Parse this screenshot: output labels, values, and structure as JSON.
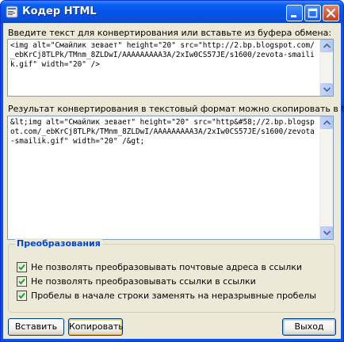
{
  "window": {
    "title": "Кодер HTML"
  },
  "input_section": {
    "label": "Введите текст для конвертирования или вставьте из буфера обмена:",
    "value": "<img alt=\"Смайлик зевает\" height=\"20\" src=\"http://2.bp.blogspot.com/_ebKrCj8TLPk/TMnm_8ZLDwI/AAAAAAAAA3A/2xIw0CS57JE/s1600/zevota-smailik.gif\" width=\"20\" />"
  },
  "output_section": {
    "label": "Результат конвертирования в текстовый формат можно скопировать в буфер обмена:",
    "value": "&lt;img alt=\"Смайлик зевает\" height=\"20\" src=\"http&#58;//2.bp.blogspot.com/_ebKrCj8TLPk/TMnm_8ZLDwI/AAAAAAAAA3A/2xIw0CS57JE/s1600/zevota-smailik.gif\" width=\"20\" /&gt;"
  },
  "options": {
    "title": "Преобразования",
    "items": [
      {
        "label": "Не позволять преобразовывать почтовые адреса в ссылки",
        "checked": true
      },
      {
        "label": "Не позволять преобразовывать ссылки в ссылки",
        "checked": true
      },
      {
        "label": "Пробелы в начале строки заменять на неразрывные пробелы",
        "checked": true
      }
    ]
  },
  "buttons": {
    "paste": "Вставить",
    "copy": "Копировать",
    "exit": "Выход"
  }
}
